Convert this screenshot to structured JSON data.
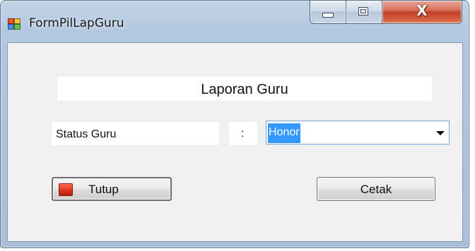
{
  "window": {
    "title": "FormPilLapGuru",
    "app_icon": "form-window-icon",
    "close_glyph": "X"
  },
  "form": {
    "heading": "Laporan Guru",
    "status_label": "Status Guru",
    "colon": ":",
    "status_select": {
      "selected": "Honor"
    },
    "buttons": {
      "tutup": "Tutup",
      "tutup_icon": "stop-icon",
      "cetak": "Cetak"
    }
  },
  "colors": {
    "selection": "#3399ff",
    "close_button": "#c2412a",
    "stop_icon": "#e0321b"
  }
}
